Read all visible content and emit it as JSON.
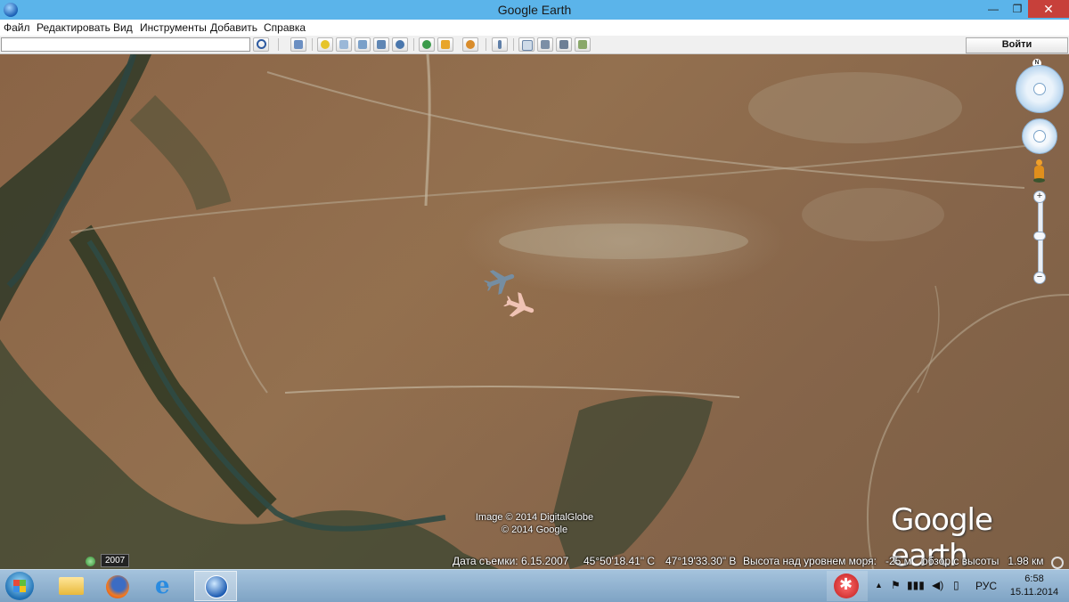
{
  "window": {
    "title": "Google Earth",
    "minimize": "—",
    "maximize": "❐",
    "close": "✕"
  },
  "menu": [
    "Файл",
    "Редактировать",
    "Вид",
    "Инструменты",
    "Добавить",
    "Справка"
  ],
  "toolbar": {
    "search_value": "",
    "search_icon": "search-icon",
    "signin_label": "Войти",
    "buttons": [
      "sidebar-toggle-icon",
      "placemark-icon",
      "polygon-icon",
      "path-icon",
      "overlay-icon",
      "tour-icon",
      "historical-imagery-icon",
      "sun-icon",
      "planets-icon",
      "ruler-icon",
      "email-icon",
      "print-icon",
      "save-image-icon",
      "view-in-maps-icon"
    ]
  },
  "map": {
    "attribution_line1": "Image © 2014 DigitalGlobe",
    "attribution_line2": "© 2014 Google",
    "logo_bold": "Google",
    "logo_light": " earth",
    "imagery_year": "2007",
    "north_label": "N",
    "zoom_in": "+",
    "zoom_out": "−"
  },
  "status": {
    "imagery_date": "Дата съемки: 6.15.2007",
    "latitude": "45°50'18.41\" С",
    "longitude": "47°19'33.30\" В",
    "elevation": "Высота над уровнем моря:   -25 м",
    "eye_alt": "обзор с высоты   1.98 км"
  },
  "taskbar": {
    "language": "РУС",
    "time": "6:58",
    "date": "15.11.2014",
    "tray_up": "▲",
    "tray_flag": "⚑",
    "tray_battery": "▯",
    "tray_sound": "◀)",
    "tray_signal": "▮▮▮"
  },
  "colors": {
    "titlebar": "#5bb4ea",
    "close": "#c7403a",
    "taskbar": "#8fb1cf"
  }
}
